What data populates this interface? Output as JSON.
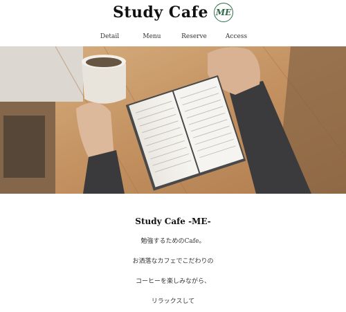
{
  "header": {
    "brand_title": "Study Cafe",
    "logo_text": "ME"
  },
  "nav": {
    "items": [
      {
        "label": "Detail"
      },
      {
        "label": "Menu"
      },
      {
        "label": "Reserve"
      },
      {
        "label": "Access"
      }
    ]
  },
  "hero": {
    "image_alt": ""
  },
  "content": {
    "title": "Study Cafe -ME-",
    "lines": [
      "勉強するためのCafe。",
      "お洒落なカフェでこだわりの",
      "コーヒーを楽しみながら、",
      "リラックスして"
    ]
  },
  "colors": {
    "logo_green": "#2f6b47",
    "wood": "#c89a66"
  }
}
